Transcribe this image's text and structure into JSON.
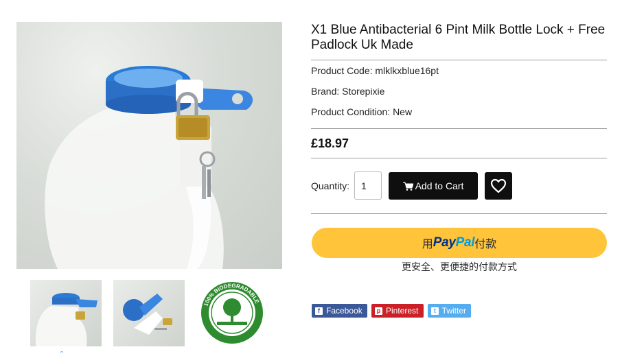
{
  "product": {
    "title": "X1 Blue Antibacterial 6 Pint Milk Bottle Lock + Free Padlock Uk Made",
    "code_label": "Product Code: mlklkxblue16pt",
    "brand_label": "Brand: Storepixie",
    "condition_label": "Product Condition: New",
    "price": "£18.97"
  },
  "gallery": {
    "main_image": "milk-bottle-lock-photo",
    "thumbnails": [
      "bottle-lock-front-photo",
      "lock-parts-photo",
      "biodegradable-badge"
    ],
    "badge_text": "100% BIODEGRADABLE",
    "thumb_caret": "^"
  },
  "purchase": {
    "quantity_label": "Quantity:",
    "quantity_value": "1",
    "add_to_cart_label": "Add to Cart",
    "cart_icon": "shopping-cart-icon",
    "wishlist_icon": "heart-icon"
  },
  "paypal": {
    "prefix": "用",
    "logo_pay": "Pay",
    "logo_pal": "Pal",
    "suffix": "付款",
    "tagline": "更安全、更便捷的付款方式",
    "button_color": "#ffc439"
  },
  "share": [
    {
      "label": "Facebook",
      "icon": "f",
      "color": "#3b5998"
    },
    {
      "label": "Pinterest",
      "icon": "p",
      "color": "#cb2027"
    },
    {
      "label": "Twitter",
      "icon": "t",
      "color": "#55acee"
    }
  ]
}
